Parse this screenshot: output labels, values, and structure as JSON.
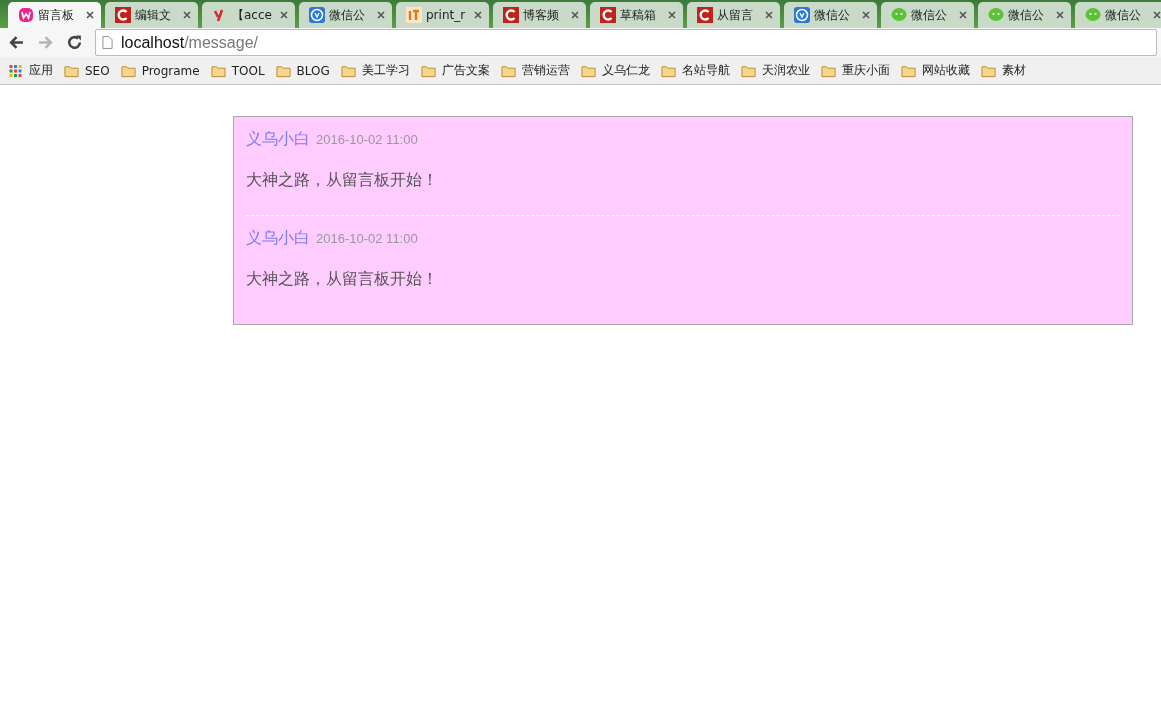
{
  "tabs": [
    {
      "title": "留言板",
      "kind": "w",
      "selected": true
    },
    {
      "title": "编辑文",
      "kind": "c",
      "selected": false
    },
    {
      "title": "【acce",
      "kind": "y",
      "selected": false
    },
    {
      "title": "微信公",
      "kind": "blue",
      "selected": false
    },
    {
      "title": "print_r",
      "kind": "it",
      "selected": false
    },
    {
      "title": "博客频",
      "kind": "c",
      "selected": false
    },
    {
      "title": "草稿箱",
      "kind": "c",
      "selected": false
    },
    {
      "title": "从留言",
      "kind": "c",
      "selected": false
    },
    {
      "title": "微信公",
      "kind": "blue",
      "selected": false
    },
    {
      "title": "微信公",
      "kind": "chat",
      "selected": false
    },
    {
      "title": "微信公",
      "kind": "chat",
      "selected": false
    },
    {
      "title": "微信公",
      "kind": "chat",
      "selected": false
    }
  ],
  "address": {
    "host": "localhost",
    "path": "/message/"
  },
  "bookmarks": [
    {
      "label": "应用",
      "kind": "apps"
    },
    {
      "label": "SEO",
      "kind": "folder"
    },
    {
      "label": "Programe",
      "kind": "folder"
    },
    {
      "label": "TOOL",
      "kind": "folder"
    },
    {
      "label": "BLOG",
      "kind": "folder"
    },
    {
      "label": "美工学习",
      "kind": "folder"
    },
    {
      "label": "广告文案",
      "kind": "folder"
    },
    {
      "label": "营销运营",
      "kind": "folder"
    },
    {
      "label": "义乌仁龙",
      "kind": "folder"
    },
    {
      "label": "名站导航",
      "kind": "folder"
    },
    {
      "label": "天润农业",
      "kind": "folder"
    },
    {
      "label": "重庆小面",
      "kind": "folder"
    },
    {
      "label": "网站收藏",
      "kind": "folder"
    },
    {
      "label": "素材",
      "kind": "folder"
    }
  ],
  "messages": [
    {
      "author": "义乌小白",
      "time": "2016-10-02 11:00",
      "text": "大神之路，从留言板开始！"
    },
    {
      "author": "义乌小白",
      "time": "2016-10-02 11:00",
      "text": "大神之路，从留言板开始！"
    }
  ]
}
